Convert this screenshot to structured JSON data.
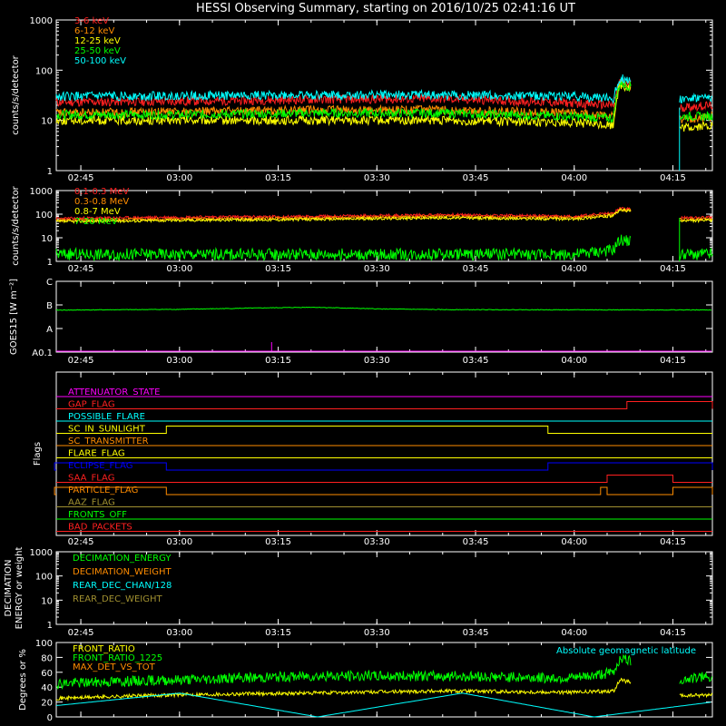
{
  "title": "HESSI Observing Summary, starting on 2016/10/25 02:41:16 UT",
  "colors": {
    "background": "#000000",
    "axes": "#ffffff",
    "red": "#ff2020",
    "orange": "#ff8c00",
    "yellow": "#ffff00",
    "green": "#00ff00",
    "cyan": "#00ffff",
    "magenta": "#ff00ff",
    "blue": "#0000ff",
    "olive": "#a09030"
  },
  "time_axis": {
    "start": "02:41:16",
    "end": "04:21:00",
    "tick_labels": [
      "02:45",
      "03:00",
      "03:15",
      "03:30",
      "03:45",
      "04:00",
      "04:15"
    ],
    "tick_times": [
      "02:45",
      "03:00",
      "03:15",
      "03:30",
      "03:45",
      "04:00",
      "04:15"
    ],
    "data_gap": [
      "04:08",
      "04:16"
    ]
  },
  "chart_data": [
    {
      "type": "line",
      "panel": "low-energy-rates",
      "ylabel": "counts/s/detector",
      "yscale": "log",
      "ylim": [
        1,
        1000
      ],
      "ytick_labels": [
        "1",
        "10",
        "100",
        "1000"
      ],
      "ytick_values": [
        1,
        10,
        100,
        1000
      ],
      "x": [
        "02:41",
        "03:00",
        "03:20",
        "03:40",
        "04:00",
        "04:06",
        "04:07",
        "04:16",
        "04:21"
      ],
      "series": [
        {
          "name": "3-6 keV",
          "color": "#ff2020",
          "values": [
            23,
            24,
            26,
            27,
            22,
            20,
            60,
            18,
            20
          ]
        },
        {
          "name": "6-12 keV",
          "color": "#ff8c00",
          "values": [
            14,
            15,
            16,
            16,
            14,
            12,
            55,
            10,
            12
          ]
        },
        {
          "name": "12-25 keV",
          "color": "#ffff00",
          "values": [
            10,
            10,
            10,
            10,
            9,
            8,
            50,
            7,
            8
          ]
        },
        {
          "name": "25-50 keV",
          "color": "#00ff00",
          "values": [
            13,
            13,
            14,
            14,
            12,
            11,
            55,
            12,
            12
          ]
        },
        {
          "name": "50-100 keV",
          "color": "#00ffff",
          "values": [
            30,
            31,
            32,
            32,
            30,
            27,
            70,
            27,
            28
          ]
        }
      ]
    },
    {
      "type": "line",
      "panel": "high-energy-rates",
      "ylabel": "counts/s/detector",
      "yscale": "log",
      "ylim": [
        1,
        1000
      ],
      "ytick_labels": [
        "1",
        "10",
        "100",
        "1000"
      ],
      "ytick_values": [
        1,
        10,
        100,
        1000
      ],
      "x": [
        "02:41",
        "03:00",
        "03:20",
        "03:40",
        "04:00",
        "04:06",
        "04:07",
        "04:16",
        "04:21"
      ],
      "series": [
        {
          "name": "0.1-0.3 MeV",
          "color": "#ff2020",
          "values": [
            65,
            75,
            80,
            95,
            80,
            110,
            180,
            70,
            75
          ]
        },
        {
          "name": "0.3-0.8 MeV",
          "color": "#ff8c00",
          "values": [
            55,
            62,
            68,
            80,
            70,
            95,
            160,
            60,
            62
          ]
        },
        {
          "name": "0.8-7 MeV",
          "color": "#ffff00",
          "values": [
            48,
            55,
            60,
            70,
            62,
            85,
            150,
            52,
            55
          ]
        },
        {
          "name": "7-20 MeV",
          "color": "#00ff00",
          "values": [
            2,
            2,
            2,
            2,
            2,
            3,
            8,
            2,
            2
          ]
        }
      ]
    },
    {
      "type": "line",
      "panel": "goes",
      "ylabel": "GOES15 [W m⁻²]",
      "ytick_labels": [
        "A0.1",
        "A",
        "B",
        "C"
      ],
      "ytick_values": [
        1e-09,
        1e-08,
        1e-07,
        1e-06
      ],
      "yscale": "log",
      "x": [
        "02:41",
        "03:00",
        "03:20",
        "03:30",
        "03:40",
        "04:00",
        "04:21"
      ],
      "series": [
        {
          "color": "#00ff00",
          "values": [
            6e-08,
            6.5e-08,
            8e-08,
            6.8e-08,
            6.3e-08,
            6.2e-08,
            6.1e-08
          ]
        },
        {
          "color": "#ff00ff",
          "values": [
            1e-09,
            1e-09,
            1e-09,
            1e-09,
            1e-09,
            1e-09,
            1e-09
          ]
        }
      ]
    },
    {
      "type": "line",
      "panel": "flags",
      "ylabel": "Flags",
      "series": [
        {
          "name": "ATTENUATOR_STATE",
          "color": "#ff00ff",
          "on": []
        },
        {
          "name": "GAP_FLAG",
          "color": "#ff2020",
          "on": [
            [
              "04:08",
              "04:21"
            ]
          ]
        },
        {
          "name": "POSSIBLE_FLARE",
          "color": "#00ffff",
          "on": []
        },
        {
          "name": "SC_IN_SUNLIGHT",
          "color": "#ffff00",
          "on": [
            [
              "02:58",
              "03:56"
            ]
          ]
        },
        {
          "name": "SC_TRANSMITTER",
          "color": "#ff8c00",
          "on": []
        },
        {
          "name": "FLARE_FLAG",
          "color": "#ffff00",
          "on": []
        },
        {
          "name": "ECLIPSE_FLAG",
          "color": "#0000ff",
          "on": [
            [
              "02:41",
              "02:58"
            ],
            [
              "03:56",
              "04:21"
            ]
          ]
        },
        {
          "name": "SAA_FLAG",
          "color": "#ff2020",
          "on": [
            [
              "04:05",
              "04:15"
            ]
          ]
        },
        {
          "name": "PARTICLE_FLAG",
          "color": "#ff8c00",
          "on": [
            [
              "02:41",
              "02:58"
            ],
            [
              "04:04",
              "04:05"
            ],
            [
              "04:15",
              "04:21"
            ]
          ]
        },
        {
          "name": "AAZ_FLAG",
          "color": "#a09030",
          "on": []
        },
        {
          "name": "FRONTS_OFF",
          "color": "#00ff00",
          "on": []
        },
        {
          "name": "BAD_PACKETS",
          "color": "#ff2020",
          "on": []
        }
      ]
    },
    {
      "type": "line",
      "panel": "decimation",
      "ylabel": "DECIMATION ENERGY or weight",
      "yscale": "log",
      "ylim": [
        1,
        1000
      ],
      "ytick_labels": [
        "1",
        "10",
        "100",
        "1000"
      ],
      "ytick_values": [
        1,
        10,
        100,
        1000
      ],
      "series": [
        {
          "name": "DECIMATION_ENERGY",
          "color": "#00ff00",
          "values": []
        },
        {
          "name": "DECIMATION_WEIGHT",
          "color": "#ff8c00",
          "values": []
        },
        {
          "name": "REAR_DEC_CHAN/128",
          "color": "#00ffff",
          "values": []
        },
        {
          "name": "REAR_DEC_WEIGHT",
          "color": "#a09030",
          "values": []
        }
      ]
    },
    {
      "type": "line",
      "panel": "ratios",
      "ylabel": "Degrees or %",
      "ylim": [
        0,
        100
      ],
      "ytick_labels": [
        "0",
        "20",
        "40",
        "60",
        "80",
        "100"
      ],
      "ytick_values": [
        0,
        20,
        40,
        60,
        80,
        100
      ],
      "annotation": "Absolute geomagnetic latitude",
      "x": [
        "02:41",
        "03:00",
        "03:20",
        "03:40",
        "04:00",
        "04:06",
        "04:07",
        "04:16",
        "04:21"
      ],
      "series": [
        {
          "name": "FRONT_RATIO",
          "color": "#ffff00",
          "values": [
            25,
            30,
            32,
            35,
            33,
            35,
            50,
            28,
            30
          ]
        },
        {
          "name": "FRONT_RATIO_1225",
          "color": "#00ff00",
          "values": [
            45,
            50,
            55,
            55,
            52,
            60,
            80,
            50,
            55
          ]
        },
        {
          "name": "MAX_DET_VS_TOT",
          "color": "#ff8c00",
          "values": []
        }
      ],
      "latitude": {
        "x": [
          "02:41",
          "03:00",
          "03:21",
          "03:43",
          "04:03",
          "04:21"
        ],
        "values": [
          15,
          32,
          0,
          32,
          0,
          20
        ]
      }
    }
  ]
}
